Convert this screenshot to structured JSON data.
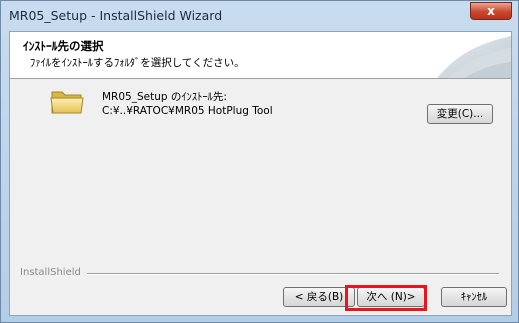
{
  "window": {
    "title": "MR05_Setup - InstallShield Wizard",
    "close_label": "x"
  },
  "header": {
    "title": "ｲﾝｽﾄｰﾙ先の選択",
    "subtitle": "ﾌｧｲﾙをｲﾝｽﾄｰﾙするﾌｫﾙﾀﾞを選択してください。"
  },
  "destination": {
    "label": "MR05_Setup のｲﾝｽﾄｰﾙ先:",
    "path": "C:¥..¥RATOC¥MR05 HotPlug Tool",
    "change_button": "変更(C)..."
  },
  "footer": {
    "brand": "InstallShield",
    "back_button": "< 戻る(B)",
    "next_button": "次へ (N)>",
    "cancel_button": "ｷｬﾝｾﾙ",
    "highlight_color": "#e8141e"
  }
}
